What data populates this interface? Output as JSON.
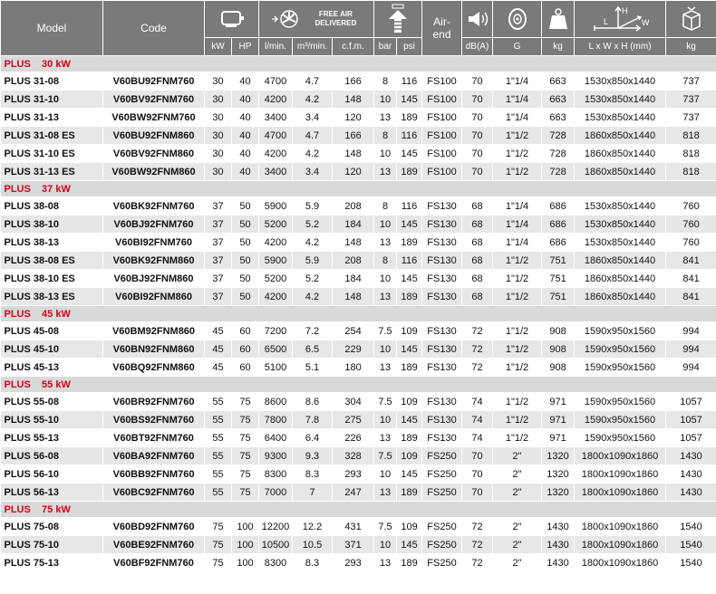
{
  "header": {
    "model": "Model",
    "code": "Code",
    "free_air_delivered": "FREE AIR DELIVERED",
    "air_end": "Air-end",
    "units": [
      "kW",
      "HP",
      "l/min.",
      "m³/min.",
      "c.f.m.",
      "bar",
      "psi",
      "dB(A)",
      "G",
      "kg",
      "L x W x H (mm)",
      "kg"
    ],
    "dim_icon_labels": {
      "l": "L",
      "h": "H",
      "w": "W"
    }
  },
  "sections": [
    {
      "title": "PLUS    30 kW",
      "rows": [
        [
          "PLUS 31-08",
          "V60BU92FNM760",
          "30",
          "40",
          "4700",
          "4.7",
          "166",
          "8",
          "116",
          "FS100",
          "70",
          "1\"1/4",
          "663",
          "1530x850x1440",
          "737"
        ],
        [
          "PLUS 31-10",
          "V60BV92FNM760",
          "30",
          "40",
          "4200",
          "4.2",
          "148",
          "10",
          "145",
          "FS100",
          "70",
          "1\"1/4",
          "663",
          "1530x850x1440",
          "737"
        ],
        [
          "PLUS 31-13",
          "V60BW92FNM760",
          "30",
          "40",
          "3400",
          "3.4",
          "120",
          "13",
          "189",
          "FS100",
          "70",
          "1\"1/4",
          "663",
          "1530x850x1440",
          "737"
        ],
        [
          "PLUS 31-08 ES",
          "V60BU92FNM860",
          "30",
          "40",
          "4700",
          "4.7",
          "166",
          "8",
          "116",
          "FS100",
          "70",
          "1\"1/2",
          "728",
          "1860x850x1440",
          "818"
        ],
        [
          "PLUS 31-10 ES",
          "V60BV92FNM860",
          "30",
          "40",
          "4200",
          "4.2",
          "148",
          "10",
          "145",
          "FS100",
          "70",
          "1\"1/2",
          "728",
          "1860x850x1440",
          "818"
        ],
        [
          "PLUS 31-13 ES",
          "V60BW92FNM860",
          "30",
          "40",
          "3400",
          "3.4",
          "120",
          "13",
          "189",
          "FS100",
          "70",
          "1\"1/2",
          "728",
          "1860x850x1440",
          "818"
        ]
      ]
    },
    {
      "title": "PLUS    37 kW",
      "rows": [
        [
          "PLUS 38-08",
          "V60BK92FNM760",
          "37",
          "50",
          "5900",
          "5.9",
          "208",
          "8",
          "116",
          "FS130",
          "68",
          "1\"1/4",
          "686",
          "1530x850x1440",
          "760"
        ],
        [
          "PLUS 38-10",
          "V60BJ92FNM760",
          "37",
          "50",
          "5200",
          "5.2",
          "184",
          "10",
          "145",
          "FS130",
          "68",
          "1\"1/4",
          "686",
          "1530x850x1440",
          "760"
        ],
        [
          "PLUS 38-13",
          "V60BI92FNM760",
          "37",
          "50",
          "4200",
          "4.2",
          "148",
          "13",
          "189",
          "FS130",
          "68",
          "1\"1/4",
          "686",
          "1530x850x1440",
          "760"
        ],
        [
          "PLUS 38-08 ES",
          "V60BK92FNM860",
          "37",
          "50",
          "5900",
          "5.9",
          "208",
          "8",
          "116",
          "FS130",
          "68",
          "1\"1/2",
          "751",
          "1860x850x1440",
          "841"
        ],
        [
          "PLUS 38-10 ES",
          "V60BJ92FNM860",
          "37",
          "50",
          "5200",
          "5.2",
          "184",
          "10",
          "145",
          "FS130",
          "68",
          "1\"1/2",
          "751",
          "1860x850x1440",
          "841"
        ],
        [
          "PLUS 38-13 ES",
          "V60BI92FNM860",
          "37",
          "50",
          "4200",
          "4.2",
          "148",
          "13",
          "189",
          "FS130",
          "68",
          "1\"1/2",
          "751",
          "1860x850x1440",
          "841"
        ]
      ]
    },
    {
      "title": "PLUS    45 kW",
      "rows": [
        [
          "PLUS 45-08",
          "V60BM92FNM860",
          "45",
          "60",
          "7200",
          "7.2",
          "254",
          "7.5",
          "109",
          "FS130",
          "72",
          "1\"1/2",
          "908",
          "1590x950x1560",
          "994"
        ],
        [
          "PLUS 45-10",
          "V60BN92FNM860",
          "45",
          "60",
          "6500",
          "6.5",
          "229",
          "10",
          "145",
          "FS130",
          "72",
          "1\"1/2",
          "908",
          "1590x950x1560",
          "994"
        ],
        [
          "PLUS 45-13",
          "V60BQ92FNM860",
          "45",
          "60",
          "5100",
          "5.1",
          "180",
          "13",
          "189",
          "FS130",
          "72",
          "1\"1/2",
          "908",
          "1590x950x1560",
          "994"
        ]
      ]
    },
    {
      "title": "PLUS    55 kW",
      "rows": [
        [
          "PLUS 55-08",
          "V60BR92FNM760",
          "55",
          "75",
          "8600",
          "8.6",
          "304",
          "7.5",
          "109",
          "FS130",
          "74",
          "1\"1/2",
          "971",
          "1590x950x1560",
          "1057"
        ],
        [
          "PLUS 55-10",
          "V60BS92FNM760",
          "55",
          "75",
          "7800",
          "7.8",
          "275",
          "10",
          "145",
          "FS130",
          "74",
          "1\"1/2",
          "971",
          "1590x950x1560",
          "1057"
        ],
        [
          "PLUS 55-13",
          "V60BT92FNM760",
          "55",
          "75",
          "6400",
          "6.4",
          "226",
          "13",
          "189",
          "FS130",
          "74",
          "1\"1/2",
          "971",
          "1590x950x1560",
          "1057"
        ],
        [
          "PLUS 56-08",
          "V60BA92FNM760",
          "55",
          "75",
          "9300",
          "9.3",
          "328",
          "7.5",
          "109",
          "FS250",
          "70",
          "2\"",
          "1320",
          "1800x1090x1860",
          "1430"
        ],
        [
          "PLUS 56-10",
          "V60BB92FNM760",
          "55",
          "75",
          "8300",
          "8.3",
          "293",
          "10",
          "145",
          "FS250",
          "70",
          "2\"",
          "1320",
          "1800x1090x1860",
          "1430"
        ],
        [
          "PLUS 56-13",
          "V60BC92FNM760",
          "55",
          "75",
          "7000",
          "7",
          "247",
          "13",
          "189",
          "FS250",
          "70",
          "2\"",
          "1320",
          "1800x1090x1860",
          "1430"
        ]
      ]
    },
    {
      "title": "PLUS    75 kW",
      "rows": [
        [
          "PLUS 75-08",
          "V60BD92FNM760",
          "75",
          "100",
          "12200",
          "12.2",
          "431",
          "7.5",
          "109",
          "FS250",
          "72",
          "2\"",
          "1430",
          "1800x1090x1860",
          "1540"
        ],
        [
          "PLUS 75-10",
          "V60BE92FNM760",
          "75",
          "100",
          "10500",
          "10.5",
          "371",
          "10",
          "145",
          "FS250",
          "72",
          "2\"",
          "1430",
          "1800x1090x1860",
          "1540"
        ],
        [
          "PLUS 75-13",
          "V60BF92FNM760",
          "75",
          "100",
          "8300",
          "8.3",
          "293",
          "13",
          "189",
          "FS250",
          "72",
          "2\"",
          "1430",
          "1800x1090x1860",
          "1540"
        ]
      ]
    }
  ]
}
